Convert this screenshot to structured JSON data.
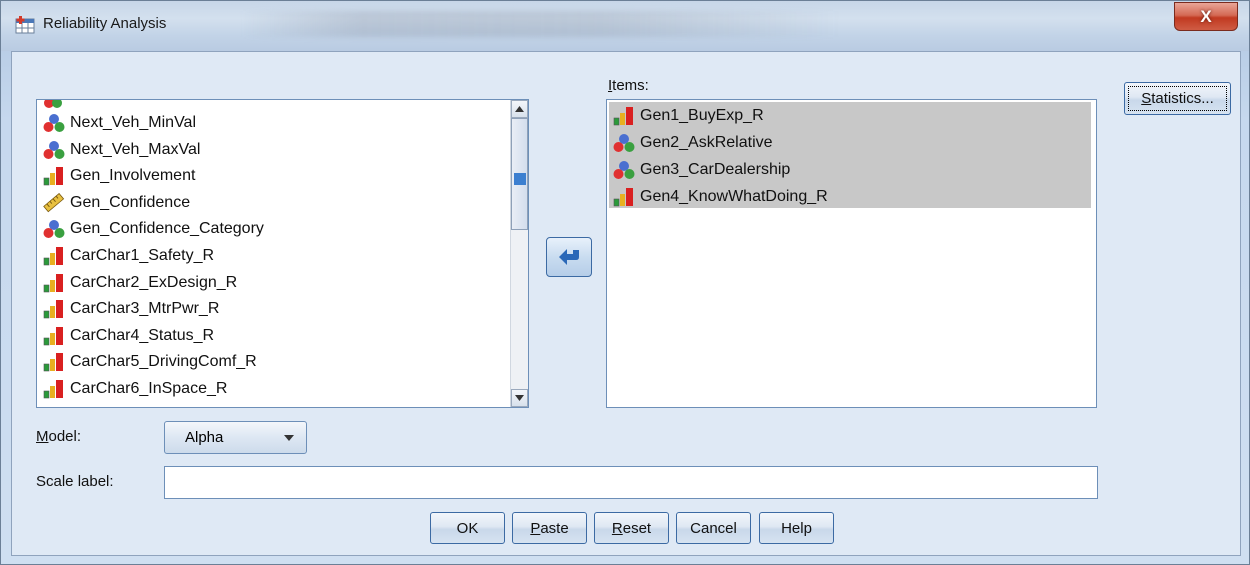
{
  "window": {
    "title": "Reliability Analysis",
    "close_label": "X"
  },
  "variables": [
    {
      "label": "Next_Veh_MinVal",
      "icon": "nominal-icon"
    },
    {
      "label": "Next_Veh_MaxVal",
      "icon": "nominal-icon"
    },
    {
      "label": "Gen_Involvement",
      "icon": "ordinal-icon"
    },
    {
      "label": "Gen_Confidence",
      "icon": "scale-icon"
    },
    {
      "label": "Gen_Confidence_Category",
      "icon": "nominal-icon"
    },
    {
      "label": "CarChar1_Safety_R",
      "icon": "ordinal-icon"
    },
    {
      "label": "CarChar2_ExDesign_R",
      "icon": "ordinal-icon"
    },
    {
      "label": "CarChar3_MtrPwr_R",
      "icon": "ordinal-icon"
    },
    {
      "label": "CarChar4_Status_R",
      "icon": "ordinal-icon"
    },
    {
      "label": "CarChar5_DrivingComf_R",
      "icon": "ordinal-icon"
    },
    {
      "label": "CarChar6_InSpace_R",
      "icon": "ordinal-icon"
    }
  ],
  "items": {
    "label": "Items:",
    "list": [
      {
        "label": "Gen1_BuyExp_R",
        "icon": "ordinal-icon"
      },
      {
        "label": "Gen2_AskRelative",
        "icon": "nominal-icon"
      },
      {
        "label": "Gen3_CarDealership",
        "icon": "nominal-icon"
      },
      {
        "label": "Gen4_KnowWhatDoing_R",
        "icon": "ordinal-icon"
      }
    ]
  },
  "statistics_button": "Statistics...",
  "model": {
    "label": "Model:",
    "value": "Alpha"
  },
  "scale_label": {
    "label": "Scale label:",
    "value": ""
  },
  "buttons": {
    "ok": "OK",
    "paste": "Paste",
    "reset": "Reset",
    "cancel": "Cancel",
    "help": "Help"
  },
  "colors": {
    "accent": "#3c7fd0",
    "selection": "#c8c8c8",
    "close": "#c13a21"
  }
}
